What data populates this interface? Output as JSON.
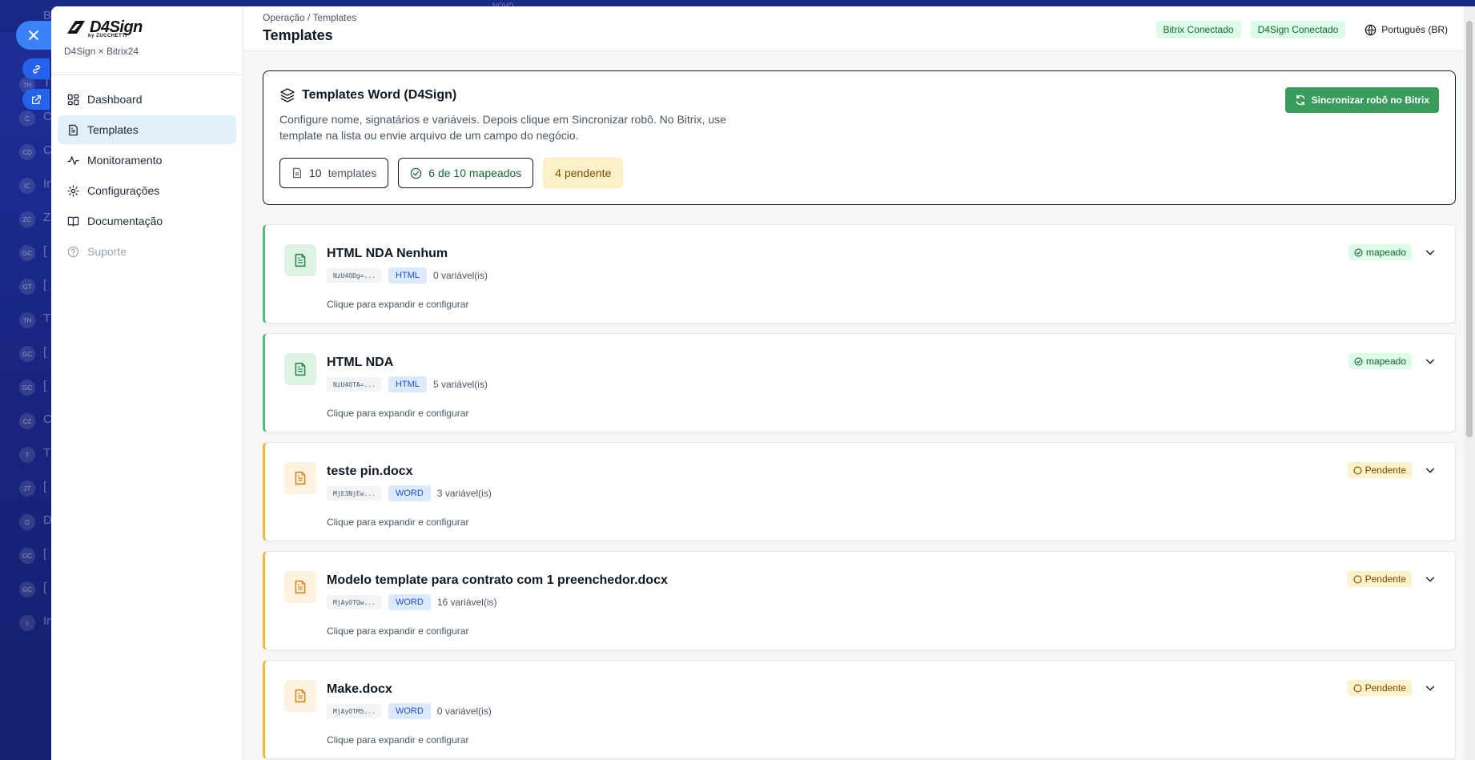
{
  "background": {
    "avatars": [
      "",
      "",
      "TH",
      "C",
      "CD",
      "IC",
      "ZC",
      "GC",
      "GT",
      "TH",
      "GC",
      "GC",
      "CZ",
      "T",
      "JT",
      "D",
      "GC",
      "GC",
      "I"
    ],
    "letters": [
      "B",
      "",
      "T",
      "C",
      "C",
      "In",
      "Z",
      "[",
      "[",
      "T",
      "[",
      "[",
      "C",
      "T",
      "[",
      "D",
      "[",
      "[",
      "In"
    ],
    "top_label": "NOVO"
  },
  "brand": {
    "logo": "D4Sign",
    "logo_sub": "by ZUCCHETTI",
    "subtitle": "D4Sign × Bitrix24"
  },
  "sidebar": {
    "items": [
      {
        "label": "Dashboard",
        "icon": "dashboard-icon"
      },
      {
        "label": "Templates",
        "icon": "file-icon"
      },
      {
        "label": "Monitoramento",
        "icon": "activity-icon"
      },
      {
        "label": "Configurações",
        "icon": "gear-icon"
      },
      {
        "label": "Documentação",
        "icon": "book-icon"
      },
      {
        "label": "Suporte",
        "icon": "help-icon"
      }
    ]
  },
  "header": {
    "breadcrumb": "Operação / Templates",
    "title": "Templates",
    "bitrix_status": "Bitrix Conectado",
    "d4sign_status": "D4Sign Conectado",
    "language": "Português (BR)"
  },
  "hero": {
    "title": "Templates Word (D4Sign)",
    "description": "Configure nome, signatários e variáveis. Depois clique em Sincronizar robô. No Bitrix, use template na lista ou envie arquivo de um campo do negócio.",
    "sync_button": "Sincronizar robô no Bitrix",
    "stats": {
      "templates_count": "10",
      "templates_label": "templates",
      "mapped": "6 de 10 mapeados",
      "pending": "4 pendente"
    }
  },
  "templates": [
    {
      "name": "HTML NDA Nenhum",
      "id": "NzU4ODg=...",
      "type": "HTML",
      "vars": "0 variável(is)",
      "hint": "Clique para expandir e configurar",
      "status": "mapeado",
      "state": "ok"
    },
    {
      "name": "HTML NDA",
      "id": "NzU4OTA=...",
      "type": "HTML",
      "vars": "5 variável(is)",
      "hint": "Clique para expandir e configurar",
      "status": "mapeado",
      "state": "ok"
    },
    {
      "name": "teste pin.docx",
      "id": "MjE3NjEw...",
      "type": "WORD",
      "vars": "3 variável(is)",
      "hint": "Clique para expandir e configurar",
      "status": "Pendente",
      "state": "wait"
    },
    {
      "name": "Modelo template para contrato com 1 preenchedor.docx",
      "id": "MjAyOTQw...",
      "type": "WORD",
      "vars": "16 variável(is)",
      "hint": "Clique para expandir e configurar",
      "status": "Pendente",
      "state": "wait"
    },
    {
      "name": "Make.docx",
      "id": "MjAyOTM5...",
      "type": "WORD",
      "vars": "0 variável(is)",
      "hint": "Clique para expandir e configurar",
      "status": "Pendente",
      "state": "wait"
    }
  ],
  "colors": {
    "accent": "#3a9c5c",
    "mapped_border": "#4ebf7a",
    "pending_border": "#f7b733",
    "active_nav": "#e0f0fb"
  }
}
